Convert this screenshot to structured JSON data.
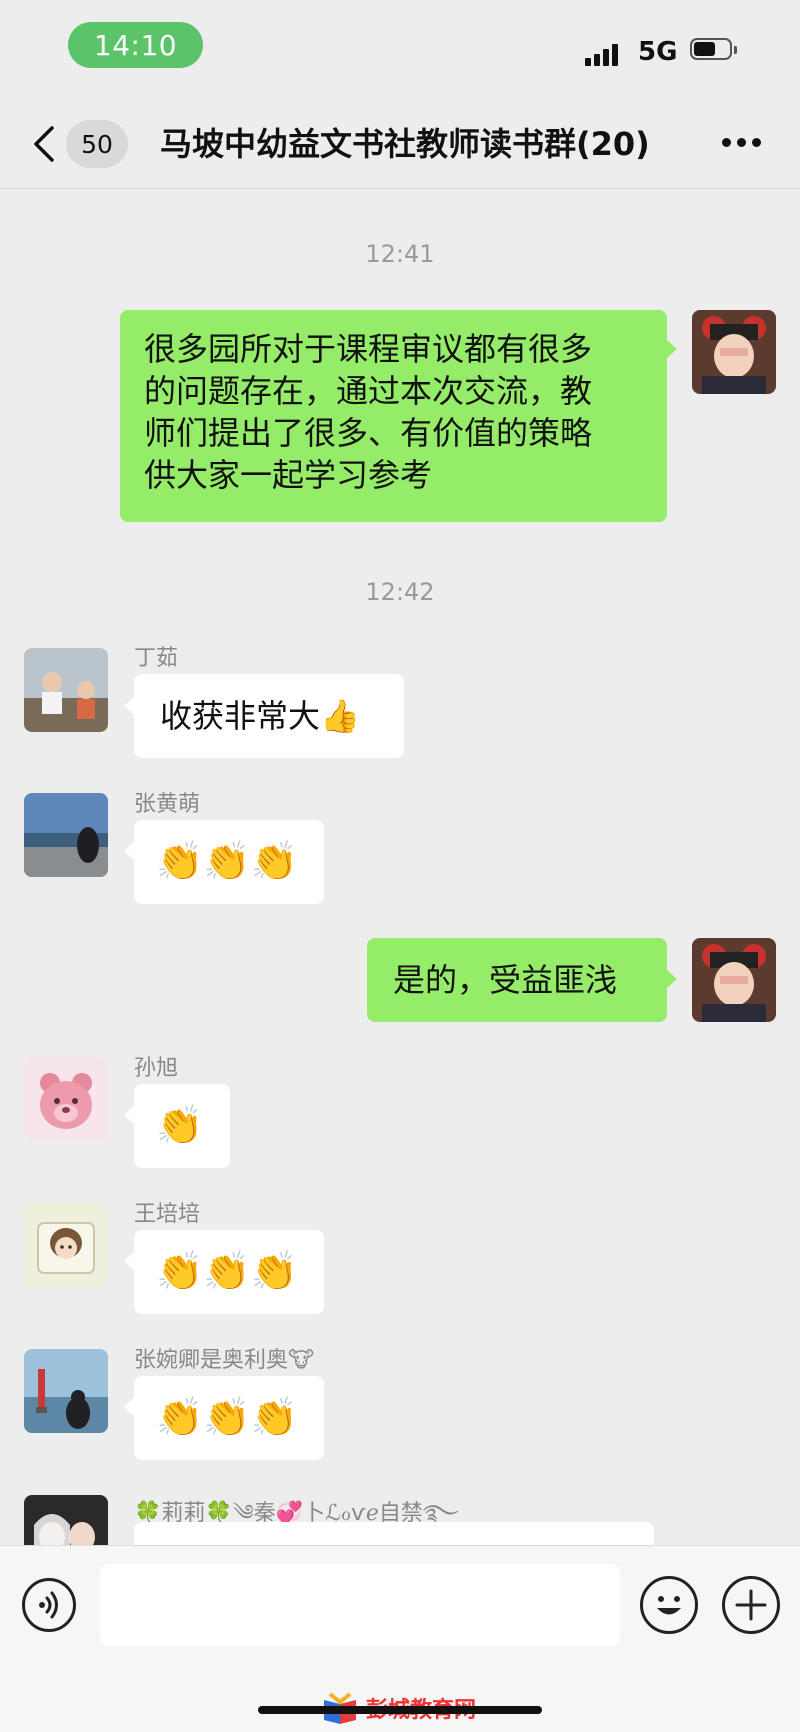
{
  "status_bar": {
    "time": "14:10",
    "network": "5G"
  },
  "nav": {
    "unread_count": "50",
    "title": "马坡中幼益文书社教师读书群(20)"
  },
  "timestamps": [
    "12:41",
    "12:42"
  ],
  "messages": [
    {
      "type": "outgoing",
      "text_lines": [
        "很多园所对于课程审议都有很多",
        "的问题存在，通过本次交流，教",
        "师们提出了很多、有价值的策略",
        "供大家一起学习参考"
      ]
    },
    {
      "type": "incoming",
      "sender": "丁茹",
      "text": "收获非常大👍"
    },
    {
      "type": "incoming",
      "sender": "张黄萌",
      "emojis": "👏👏👏"
    },
    {
      "type": "outgoing",
      "text": "是的，受益匪浅"
    },
    {
      "type": "incoming",
      "sender": "孙旭",
      "emojis": "👏"
    },
    {
      "type": "incoming",
      "sender": "王培培",
      "emojis": "👏👏👏"
    },
    {
      "type": "incoming",
      "sender": "张婉卿是奥利奥🐮",
      "emojis": "👏👏👏"
    },
    {
      "type": "incoming",
      "sender": "🍀莉莉🍀༄秦💞卜ℒℴѵℯ自禁࿐"
    }
  ],
  "icons": {
    "back": "chevron-left-icon",
    "more": "more-dots-icon",
    "voice": "voice-icon",
    "emoji": "emoji-icon",
    "plus": "plus-icon"
  },
  "colors": {
    "outgoing_bubble": "#95ec69",
    "incoming_bubble": "#ffffff",
    "background": "#ededed",
    "time_pill": "#5bc46a"
  },
  "watermark": {
    "text": "彭城教育网"
  }
}
